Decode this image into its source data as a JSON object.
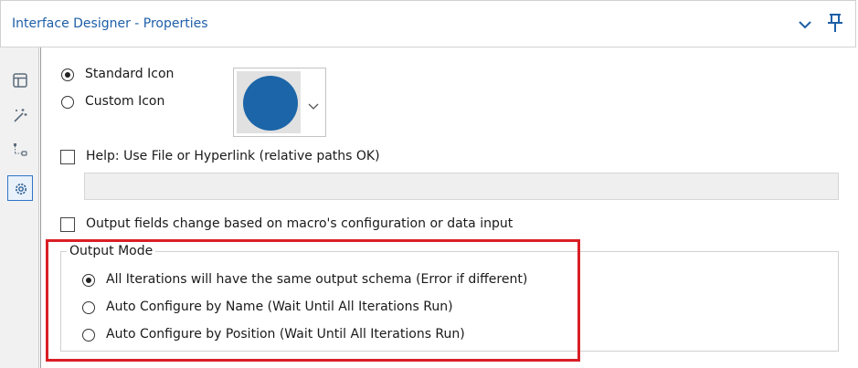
{
  "window": {
    "title": "Interface Designer - Properties",
    "icons": [
      "chevron-down-icon",
      "pin-icon"
    ],
    "accent_color": "#1e5fa8"
  },
  "toolbar": {
    "items": [
      {
        "icon": "layout-icon"
      },
      {
        "icon": "magic-wand-icon"
      },
      {
        "icon": "tree-view-icon"
      },
      {
        "icon": "gear-icon",
        "active": true
      }
    ]
  },
  "properties": {
    "icon_options": [
      {
        "label": "Standard Icon",
        "selected": true
      },
      {
        "label": "Custom Icon",
        "selected": false
      }
    ],
    "icon_color": "#1c65a8",
    "help": {
      "label": "Help: Use File or Hyperlink (relative paths OK)",
      "checked": false,
      "value": ""
    },
    "output_fields_change": {
      "label": "Output fields change based on macro's configuration or data input",
      "checked": false
    },
    "output_mode": {
      "legend": "Output Mode",
      "options": [
        {
          "label": "All Iterations will have the same output schema (Error if different)",
          "selected": true
        },
        {
          "label": "Auto Configure by Name (Wait Until All Iterations Run)",
          "selected": false
        },
        {
          "label": "Auto Configure by Position (Wait Until All Iterations Run)",
          "selected": false
        }
      ],
      "highlight_color": "#d91f26"
    }
  }
}
